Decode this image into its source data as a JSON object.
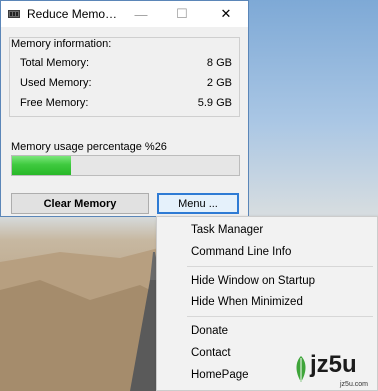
{
  "window": {
    "title": "Reduce Memo…",
    "minimize_glyph": "—",
    "maximize_glyph": "☐",
    "close_glyph": "✕"
  },
  "memory_info": {
    "heading": "Memory information:",
    "total_label": "Total Memory:",
    "total_value": "8 GB",
    "used_label": "Used Memory:",
    "used_value": "2 GB",
    "free_label": "Free Memory:",
    "free_value": "5.9 GB"
  },
  "usage": {
    "label": "Memory usage percentage %26",
    "percent": 26
  },
  "buttons": {
    "clear_label": "Clear Memory",
    "menu_label": "Menu ..."
  },
  "menu": {
    "items": [
      "Task Manager",
      "Command Line Info",
      "Hide Window on Startup",
      "Hide When Minimized",
      "Donate",
      "Contact",
      "HomePage"
    ]
  },
  "watermark": {
    "text": "jz5u",
    "sub": "jz5u.com"
  },
  "colors": {
    "accent": "#2f7bd4",
    "progress": "#3fca3f"
  }
}
